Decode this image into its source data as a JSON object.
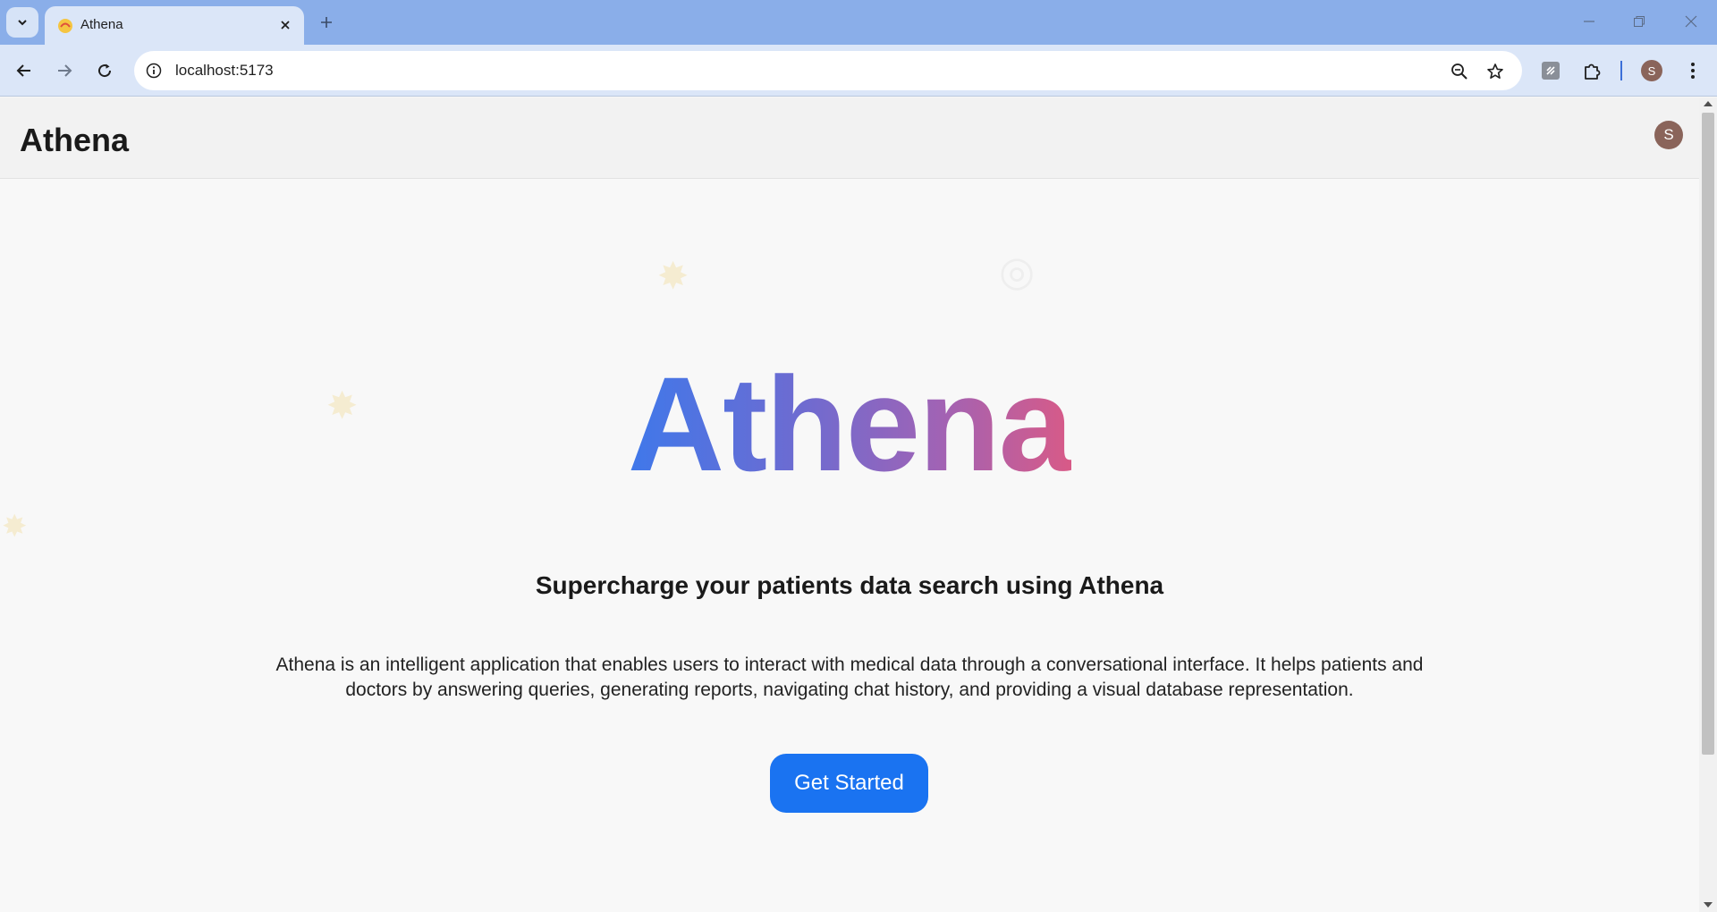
{
  "browser": {
    "tab_title": "Athena",
    "url": "localhost:5173",
    "profile_initial": "S"
  },
  "app": {
    "brand": "Athena",
    "avatar_initial": "S"
  },
  "hero": {
    "title": "Athena",
    "subtitle": "Supercharge your patients data search using Athena",
    "description": "Athena is an intelligent application that enables users to interact with medical data through a conversational interface. It helps patients and doctors by answering queries, generating reports, navigating chat history, and providing a visual database representation.",
    "cta_label": "Get Started"
  },
  "colors": {
    "gradient_start": "#3f78ea",
    "gradient_end": "#d85a87",
    "cta": "#1a73f1"
  }
}
